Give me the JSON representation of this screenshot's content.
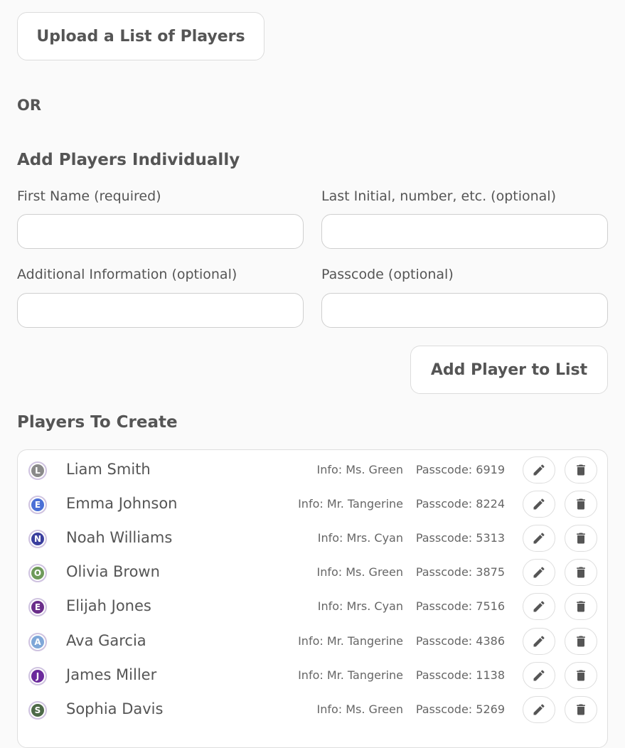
{
  "upload_button_label": "Upload a List of Players",
  "or_label": "OR",
  "add_section": {
    "title": "Add Players Individually",
    "first_name_label": "First Name (required)",
    "first_name_value": "",
    "last_initial_label": "Last Initial, number, etc. (optional)",
    "last_initial_value": "",
    "additional_info_label": "Additional Information (optional)",
    "additional_info_value": "",
    "passcode_label": "Passcode (optional)",
    "passcode_value": "",
    "add_button_label": "Add Player to List"
  },
  "players_section": {
    "title": "Players To Create",
    "players": [
      {
        "initial": "L",
        "name": "Liam Smith",
        "info": "Info: Ms. Green",
        "passcode": "Passcode: 6919",
        "avatar_color": "#8a8a8a"
      },
      {
        "initial": "E",
        "name": "Emma Johnson",
        "info": "Info: Mr. Tangerine",
        "passcode": "Passcode: 8224",
        "avatar_color": "#4a6fd6"
      },
      {
        "initial": "N",
        "name": "Noah Williams",
        "info": "Info: Mrs. Cyan",
        "passcode": "Passcode: 5313",
        "avatar_color": "#3b3f9e"
      },
      {
        "initial": "O",
        "name": "Olivia Brown",
        "info": "Info: Ms. Green",
        "passcode": "Passcode: 3875",
        "avatar_color": "#6e9a5a"
      },
      {
        "initial": "E",
        "name": "Elijah Jones",
        "info": "Info: Mrs. Cyan",
        "passcode": "Passcode: 7516",
        "avatar_color": "#6a2d8a"
      },
      {
        "initial": "A",
        "name": "Ava Garcia",
        "info": "Info: Mr. Tangerine",
        "passcode": "Passcode: 4386",
        "avatar_color": "#7fa7d8"
      },
      {
        "initial": "J",
        "name": "James Miller",
        "info": "Info: Mr. Tangerine",
        "passcode": "Passcode: 1138",
        "avatar_color": "#6b2a9c"
      },
      {
        "initial": "S",
        "name": "Sophia Davis",
        "info": "Info: Ms. Green",
        "passcode": "Passcode: 5269",
        "avatar_color": "#4d6a48"
      }
    ]
  },
  "icons": {
    "edit": "pencil-icon",
    "delete": "trash-icon"
  }
}
